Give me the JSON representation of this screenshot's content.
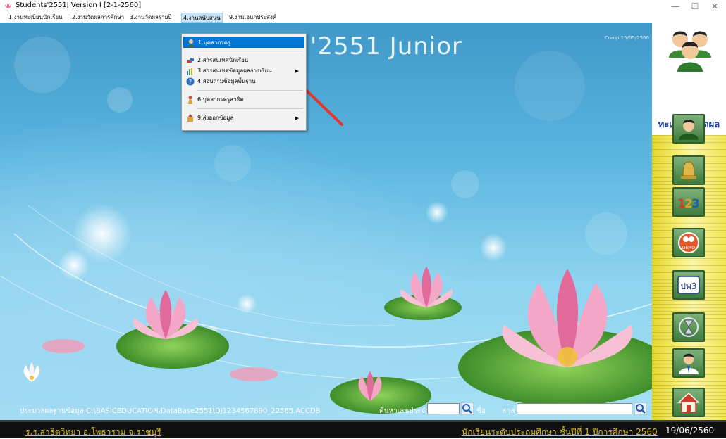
{
  "window": {
    "title": "Students'2551J Version I [2-1-2560]",
    "icons": {
      "app": "lotus-icon",
      "minimize": "minimize-icon",
      "maximize": "maximize-icon",
      "close": "close-icon"
    }
  },
  "menu": {
    "items": [
      {
        "label": "1.งานทะเบียนนักเรียน"
      },
      {
        "label": "2.งานวัดผลการศึกษา"
      },
      {
        "label": "3.งานวัดผลรายปี"
      },
      {
        "label": "4.งานสนับสนุน"
      },
      {
        "label": "9.งานเอนกประสงค์"
      }
    ],
    "active_index": 3
  },
  "dropdown": {
    "items": [
      {
        "label": "1.บุคลากรครู",
        "icon": "teacher-icon",
        "selected": true,
        "submenu": false
      },
      {
        "label": "2.สารสนเทศนักเรียน",
        "icon": "cars-icon",
        "selected": false,
        "submenu": false
      },
      {
        "label": "3.สารสนเทศข้อมูลผลการเรียน",
        "icon": "bar-chart-icon",
        "selected": false,
        "submenu": true
      },
      {
        "label": "4.สอบถามข้อมูลพื้นฐาน",
        "icon": "info-icon",
        "selected": false,
        "submenu": false
      },
      {
        "label": "6.บุคลากรครูสาธิต",
        "icon": "person-icon",
        "selected": false,
        "submenu": false
      },
      {
        "label": "9.ส่งออกข้อมูล",
        "icon": "export-icon",
        "selected": false,
        "submenu": true
      }
    ]
  },
  "main": {
    "title": "'2551 Junior",
    "comp_date": "Comp.15/05/2560",
    "db_path": "ประมวลผลฐานข้อมูล C:\\BASICEDUCATION\\DataBase2551\\DJ1234567890_22565.ACCDB",
    "search_label": "ค้นหาเลขประจำตัว",
    "search_value": "",
    "name_label": "ชื่อ",
    "surname_label": "สกุล",
    "name_value": ""
  },
  "right_panel": {
    "label": "ทะเบียน&วัดผล",
    "buttons": [
      {
        "icon": "student-icon"
      },
      {
        "icon": "bell-icon"
      },
      {
        "icon": "numbers-123-icon"
      },
      {
        "icon": "demo-icon"
      },
      {
        "icon": "pw3-icon",
        "text": "ปพ3"
      },
      {
        "icon": "hourglass-icon"
      },
      {
        "icon": "teacher-icon"
      },
      {
        "icon": "home-icon"
      }
    ]
  },
  "status": {
    "school": "ร.ร.สาธิตวิทยา อ.โพธาราม จ.ราชบุรี",
    "level": "นักเรียนระดับประถมศึกษา ชั้นปีที่ 1 ปีการศึกษา 2560",
    "date": "19/06/2560"
  },
  "colors": {
    "accent": "#0078d7",
    "status_text": "#e5c419",
    "panel_label": "#1a3f9c"
  }
}
